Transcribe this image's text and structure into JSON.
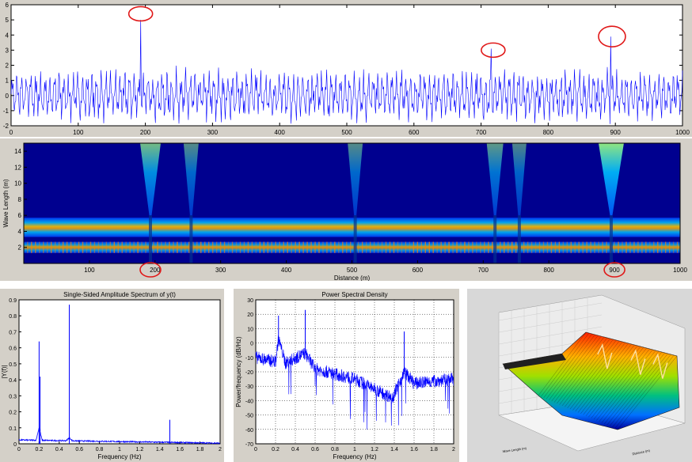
{
  "colors": {
    "signal": "#0000ff",
    "circle": "#e01818",
    "panel_bg": "#d4d0c8",
    "axes_bg": "#ffffff"
  },
  "chart_data": [
    {
      "id": "signal",
      "type": "line",
      "title": "",
      "xlabel": "",
      "ylabel": "",
      "xlim": [
        0,
        1000
      ],
      "ylim": [
        -2,
        6
      ],
      "xticks": [
        0,
        100,
        200,
        300,
        400,
        500,
        600,
        700,
        800,
        900,
        1000
      ],
      "yticks": [
        -2,
        -1,
        0,
        1,
        2,
        3,
        4,
        5,
        6
      ],
      "grid": false,
      "series": [
        {
          "pattern": "oscillation between -1.9 and 2.0",
          "base_amplitude": 2
        }
      ],
      "spikes": [
        {
          "x": 193,
          "y": 5.0
        },
        {
          "x": 715,
          "y": 3.1
        },
        {
          "x": 893,
          "y": 3.9
        }
      ],
      "annotations": [
        {
          "type": "ellipse",
          "x": 193,
          "y": 5.4
        },
        {
          "type": "ellipse",
          "x": 718,
          "y": 3.0
        },
        {
          "type": "ellipse",
          "x": 895,
          "y": 3.9
        }
      ]
    },
    {
      "id": "wavelength-map",
      "type": "heatmap",
      "title": "",
      "xlabel": "Distance (m)",
      "ylabel": "Wave Length (m)",
      "xlim": [
        0,
        1000
      ],
      "ylim": [
        0,
        15
      ],
      "xticks": [
        100,
        200,
        300,
        400,
        500,
        600,
        700,
        800,
        900,
        1000
      ],
      "yticks": [
        2,
        4,
        6,
        8,
        10,
        12,
        14
      ],
      "xtick_labels": [
        "100",
        "200",
        "300",
        "400",
        "500",
        "600",
        "700",
        "800",
        "900",
        "1000"
      ],
      "bands": [
        {
          "y_low": 1.3,
          "y_high": 2.7,
          "level": 0.45
        },
        {
          "y_low": 3.3,
          "y_high": 5.7,
          "level": 0.6
        }
      ],
      "features": [
        {
          "x": 193,
          "strength": 0.7
        },
        {
          "x": 255,
          "strength": 0.35
        },
        {
          "x": 505,
          "strength": 0.35
        },
        {
          "x": 718,
          "strength": 0.45
        },
        {
          "x": 755,
          "strength": 0.3
        },
        {
          "x": 895,
          "strength": 1.0
        }
      ],
      "annotations": [
        {
          "type": "ellipse",
          "x": 193
        },
        {
          "type": "ellipse",
          "x": 900
        }
      ]
    },
    {
      "id": "amplitude-spectrum",
      "type": "line",
      "title": "Single-Sided Amplitude Spectrum of y(t)",
      "xlabel": "Frequency (Hz)",
      "ylabel": "|Y(f)|",
      "xlim": [
        0,
        2
      ],
      "ylim": [
        0,
        0.9
      ],
      "xticks": [
        0,
        0.2,
        0.4,
        0.6,
        0.8,
        1,
        1.2,
        1.4,
        1.6,
        1.8,
        2
      ],
      "xtick_labels": [
        "0",
        "0.2",
        "0.4",
        "0.6",
        "0.8",
        "1",
        "1.2",
        "1.4",
        "1.6",
        "1.8",
        "2"
      ],
      "yticks": [
        0,
        0.1,
        0.2,
        0.3,
        0.4,
        0.5,
        0.6,
        0.7,
        0.8,
        0.9
      ],
      "ytick_labels": [
        "0",
        "0.1",
        "0.2",
        "0.3",
        "0.4",
        "0.5",
        "0.6",
        "0.7",
        "0.8",
        "0.9"
      ],
      "grid": false,
      "peaks": [
        {
          "x": 0.2,
          "y": 0.64
        },
        {
          "x": 0.21,
          "y": 0.42
        },
        {
          "x": 0.5,
          "y": 0.87
        },
        {
          "x": 1.5,
          "y": 0.15
        }
      ],
      "baseline": 0.02
    },
    {
      "id": "psd",
      "type": "line",
      "title": "Power Spectral Density",
      "xlabel": "Frequency (Hz)",
      "ylabel": "Power/frequency (dB/Hz)",
      "xlim": [
        0,
        2
      ],
      "ylim": [
        -70,
        30
      ],
      "xticks": [
        0,
        0.2,
        0.4,
        0.6,
        0.8,
        1,
        1.2,
        1.4,
        1.6,
        1.8,
        2
      ],
      "xtick_labels": [
        "0",
        "0.2",
        "0.4",
        "0.6",
        "0.8",
        "1",
        "1.2",
        "1.4",
        "1.6",
        "1.8",
        "2"
      ],
      "yticks": [
        -70,
        -60,
        -50,
        -40,
        -30,
        -20,
        -10,
        0,
        10,
        20,
        30
      ],
      "ytick_labels": [
        "-70",
        "-60",
        "-50",
        "-40",
        "-30",
        "-20",
        "-10",
        "0",
        "10",
        "20",
        "30"
      ],
      "grid": true,
      "trend": [
        [
          0,
          -10
        ],
        [
          0.2,
          -13
        ],
        [
          0.23,
          3
        ],
        [
          0.3,
          -14
        ],
        [
          0.5,
          -7
        ],
        [
          0.6,
          -18
        ],
        [
          1.0,
          -25
        ],
        [
          1.2,
          -32
        ],
        [
          1.38,
          -38
        ],
        [
          1.5,
          -20
        ],
        [
          1.6,
          -28
        ],
        [
          2,
          -25
        ]
      ],
      "spikes": [
        {
          "x": 0.23,
          "y": 19
        },
        {
          "x": 0.5,
          "y": 23
        },
        {
          "x": 1.5,
          "y": 8
        }
      ]
    },
    {
      "id": "surface-3d",
      "type": "surface",
      "xlabel": "Wave Length (m)",
      "ylabel": "Distance (m)",
      "ridge_positions": [
        0.32,
        0.62,
        0.82
      ]
    }
  ]
}
